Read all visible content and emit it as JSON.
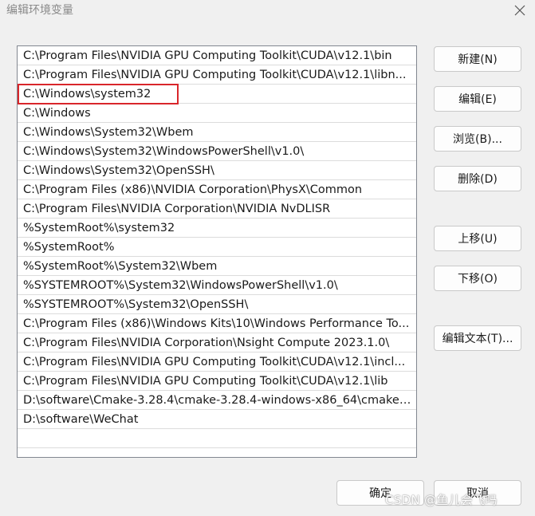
{
  "window": {
    "title": "编辑环境变量",
    "close_icon": "close-icon"
  },
  "paths": [
    "C:\\Program Files\\NVIDIA GPU Computing Toolkit\\CUDA\\v12.1\\bin",
    "C:\\Program Files\\NVIDIA GPU Computing Toolkit\\CUDA\\v12.1\\libn...",
    "C:\\Windows\\system32",
    "C:\\Windows",
    "C:\\Windows\\System32\\Wbem",
    "C:\\Windows\\System32\\WindowsPowerShell\\v1.0\\",
    "C:\\Windows\\System32\\OpenSSH\\",
    "C:\\Program Files (x86)\\NVIDIA Corporation\\PhysX\\Common",
    "C:\\Program Files\\NVIDIA Corporation\\NVIDIA NvDLISR",
    "%SystemRoot%\\system32",
    "%SystemRoot%",
    "%SystemRoot%\\System32\\Wbem",
    "%SYSTEMROOT%\\System32\\WindowsPowerShell\\v1.0\\",
    "%SYSTEMROOT%\\System32\\OpenSSH\\",
    "C:\\Program Files (x86)\\Windows Kits\\10\\Windows Performance To...",
    "C:\\Program Files\\NVIDIA Corporation\\Nsight Compute 2023.1.0\\",
    "C:\\Program Files\\NVIDIA GPU Computing Toolkit\\CUDA\\v12.1\\incl...",
    "C:\\Program Files\\NVIDIA GPU Computing Toolkit\\CUDA\\v12.1\\lib",
    "D:\\software\\Cmake-3.28.4\\cmake-3.28.4-windows-x86_64\\cmake-...",
    "D:\\software\\WeChat"
  ],
  "highlighted_index": 2,
  "highlight_color": "#d9262b",
  "buttons": {
    "new": "新建(N)",
    "edit": "编辑(E)",
    "browse": "浏览(B)...",
    "delete": "删除(D)",
    "move_up": "上移(U)",
    "move_down": "下移(O)",
    "edit_text": "编辑文本(T)...",
    "ok": "确定",
    "cancel": "取消"
  },
  "watermark": "CSDN @鱼儿会飞吗"
}
